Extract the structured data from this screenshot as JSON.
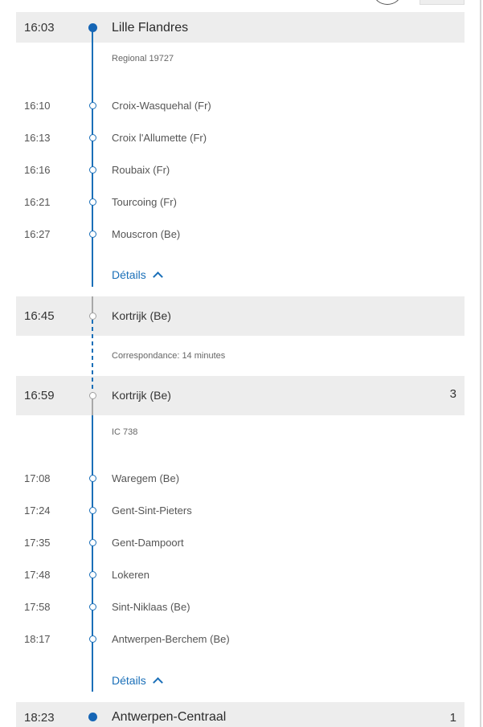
{
  "journey": {
    "origin": {
      "time": "16:03",
      "station": "Lille Flandres"
    },
    "leg1": {
      "train": "Regional 19727",
      "stops": [
        {
          "time": "16:10",
          "station": "Croix-Wasquehal (Fr)"
        },
        {
          "time": "16:13",
          "station": "Croix l'Allumette (Fr)"
        },
        {
          "time": "16:16",
          "station": "Roubaix (Fr)"
        },
        {
          "time": "16:21",
          "station": "Tourcoing (Fr)"
        },
        {
          "time": "16:27",
          "station": "Mouscron (Be)"
        }
      ],
      "details_label": "Détails"
    },
    "transfer_arrival": {
      "time": "16:45",
      "station": "Kortrijk (Be)"
    },
    "connection_text": "Correspondance: 14 minutes",
    "transfer_departure": {
      "time": "16:59",
      "station": "Kortrijk (Be)",
      "platform": "3"
    },
    "leg2": {
      "train": "IC 738",
      "stops": [
        {
          "time": "17:08",
          "station": "Waregem (Be)"
        },
        {
          "time": "17:24",
          "station": "Gent-Sint-Pieters"
        },
        {
          "time": "17:35",
          "station": "Gent-Dampoort"
        },
        {
          "time": "17:48",
          "station": "Lokeren"
        },
        {
          "time": "17:58",
          "station": "Sint-Niklaas (Be)"
        },
        {
          "time": "18:17",
          "station": "Antwerpen-Berchem (Be)"
        }
      ],
      "details_label": "Détails"
    },
    "destination": {
      "time": "18:23",
      "station": "Antwerpen-Centraal",
      "platform": "1"
    }
  },
  "colors": {
    "accent": "#1a6fb8",
    "band": "#ededed",
    "text": "#3a3a3a"
  }
}
